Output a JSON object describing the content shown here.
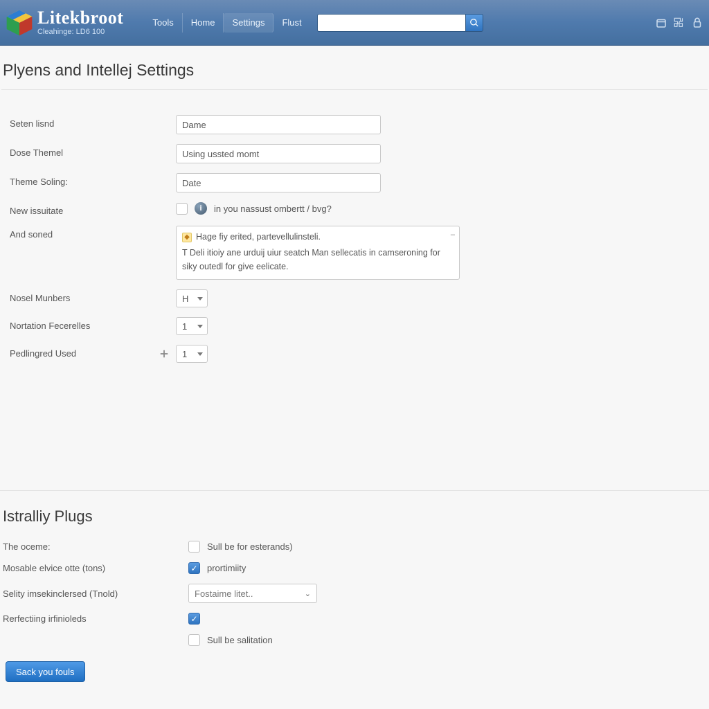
{
  "header": {
    "brand": "Litekbroot",
    "tagline": "Cleahinge: LD6 100",
    "nav": [
      "Tools",
      "Home",
      "Settings",
      "Flust"
    ],
    "nav_active_index": 2,
    "search_placeholder": ""
  },
  "page": {
    "title": "Plyens and Intellej Settings"
  },
  "form1": {
    "rows": {
      "seten": {
        "label": "Seten lisnd",
        "value": "Dame"
      },
      "dose": {
        "label": "Dose Themel",
        "value": "Using ussted momt"
      },
      "theme": {
        "label": "Theme Soling:",
        "value": "Date"
      },
      "newiss": {
        "label": "New issuitate",
        "hint": "in you nassust ombertt / bvg?"
      },
      "andsoned": {
        "label": "And soned",
        "note_title": "Hage fiy erited, partevellulinsteli.",
        "note_body": "T Deli itioiy ane urduij uiur seatch Man sellecatis in camseroning for siky outedl for give eelicate."
      },
      "nosel": {
        "label": "Nosel Munbers",
        "value": "H"
      },
      "notation": {
        "label": "Nortation Fecerelles",
        "value": "1"
      },
      "pedl": {
        "label": "Pedlingred Used",
        "value": "1"
      }
    }
  },
  "section2": {
    "title": "Istralliy Plugs",
    "rows": {
      "oceme": {
        "label": "The oceme:",
        "chk_label": "Sull be for esterands)",
        "checked": false
      },
      "mosable": {
        "label": "Mosable elvice otte (tons)",
        "chk_label": "prortimiity",
        "checked": true
      },
      "selity": {
        "label": "Selity imsekinclersed (Tnold)",
        "select_value": "Fostaime litet.."
      },
      "refect": {
        "label": "Rerfectiing irfinioleds",
        "checked": true
      },
      "extra": {
        "chk_label": "Sull be salitation",
        "checked": false
      }
    }
  },
  "actions": {
    "save": "Sack you fouls"
  }
}
